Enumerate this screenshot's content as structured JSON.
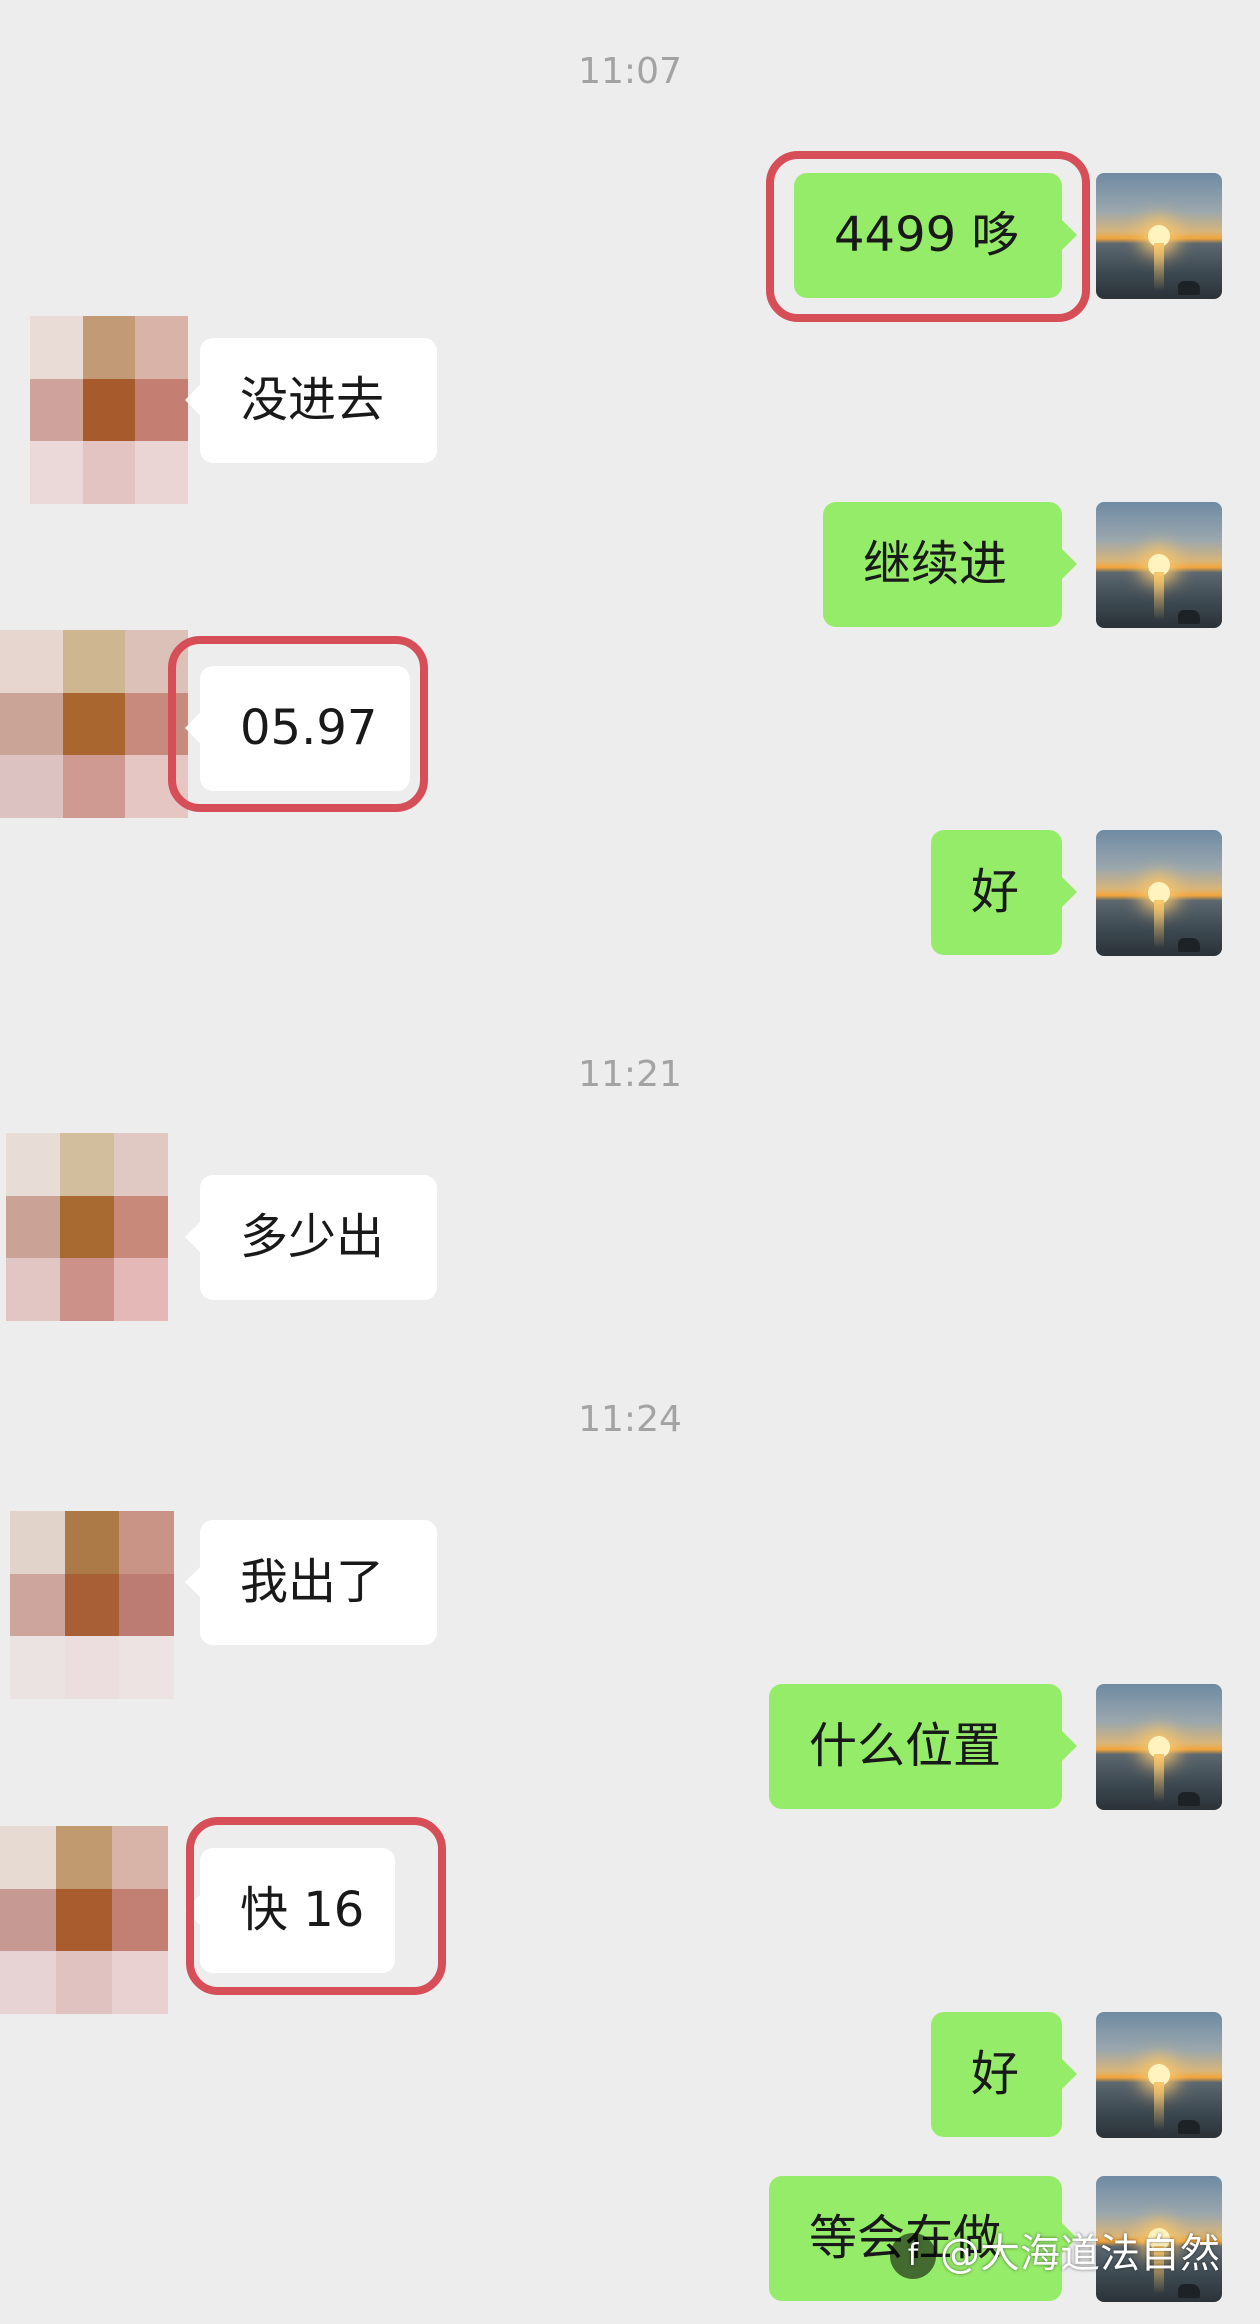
{
  "timestamps": [
    "11:07",
    "11:21",
    "11:24"
  ],
  "messages": [
    {
      "side": "right",
      "text": "4499 哆"
    },
    {
      "side": "left",
      "text": "没进去"
    },
    {
      "side": "right",
      "text": "继续进"
    },
    {
      "side": "left",
      "text": "05.97"
    },
    {
      "side": "right",
      "text": "好"
    },
    {
      "side": "left",
      "text": "多少出"
    },
    {
      "side": "left",
      "text": "我出了"
    },
    {
      "side": "right",
      "text": "什么位置"
    },
    {
      "side": "left",
      "text": "快 16"
    },
    {
      "side": "right",
      "text": "好"
    },
    {
      "side": "right",
      "text": "等会在做"
    }
  ],
  "watermark": {
    "text": "@大海道法自然",
    "logo_glyph": "f"
  },
  "colors": {
    "background": "#ededed",
    "sent_bubble": "#95ec69",
    "received_bubble": "#ffffff",
    "timestamp": "#a3a3a3",
    "highlight": "#d64f58"
  },
  "icons": [
    "sunset-avatar-icon",
    "pixelated-avatar-icon",
    "watermark-logo-icon"
  ]
}
